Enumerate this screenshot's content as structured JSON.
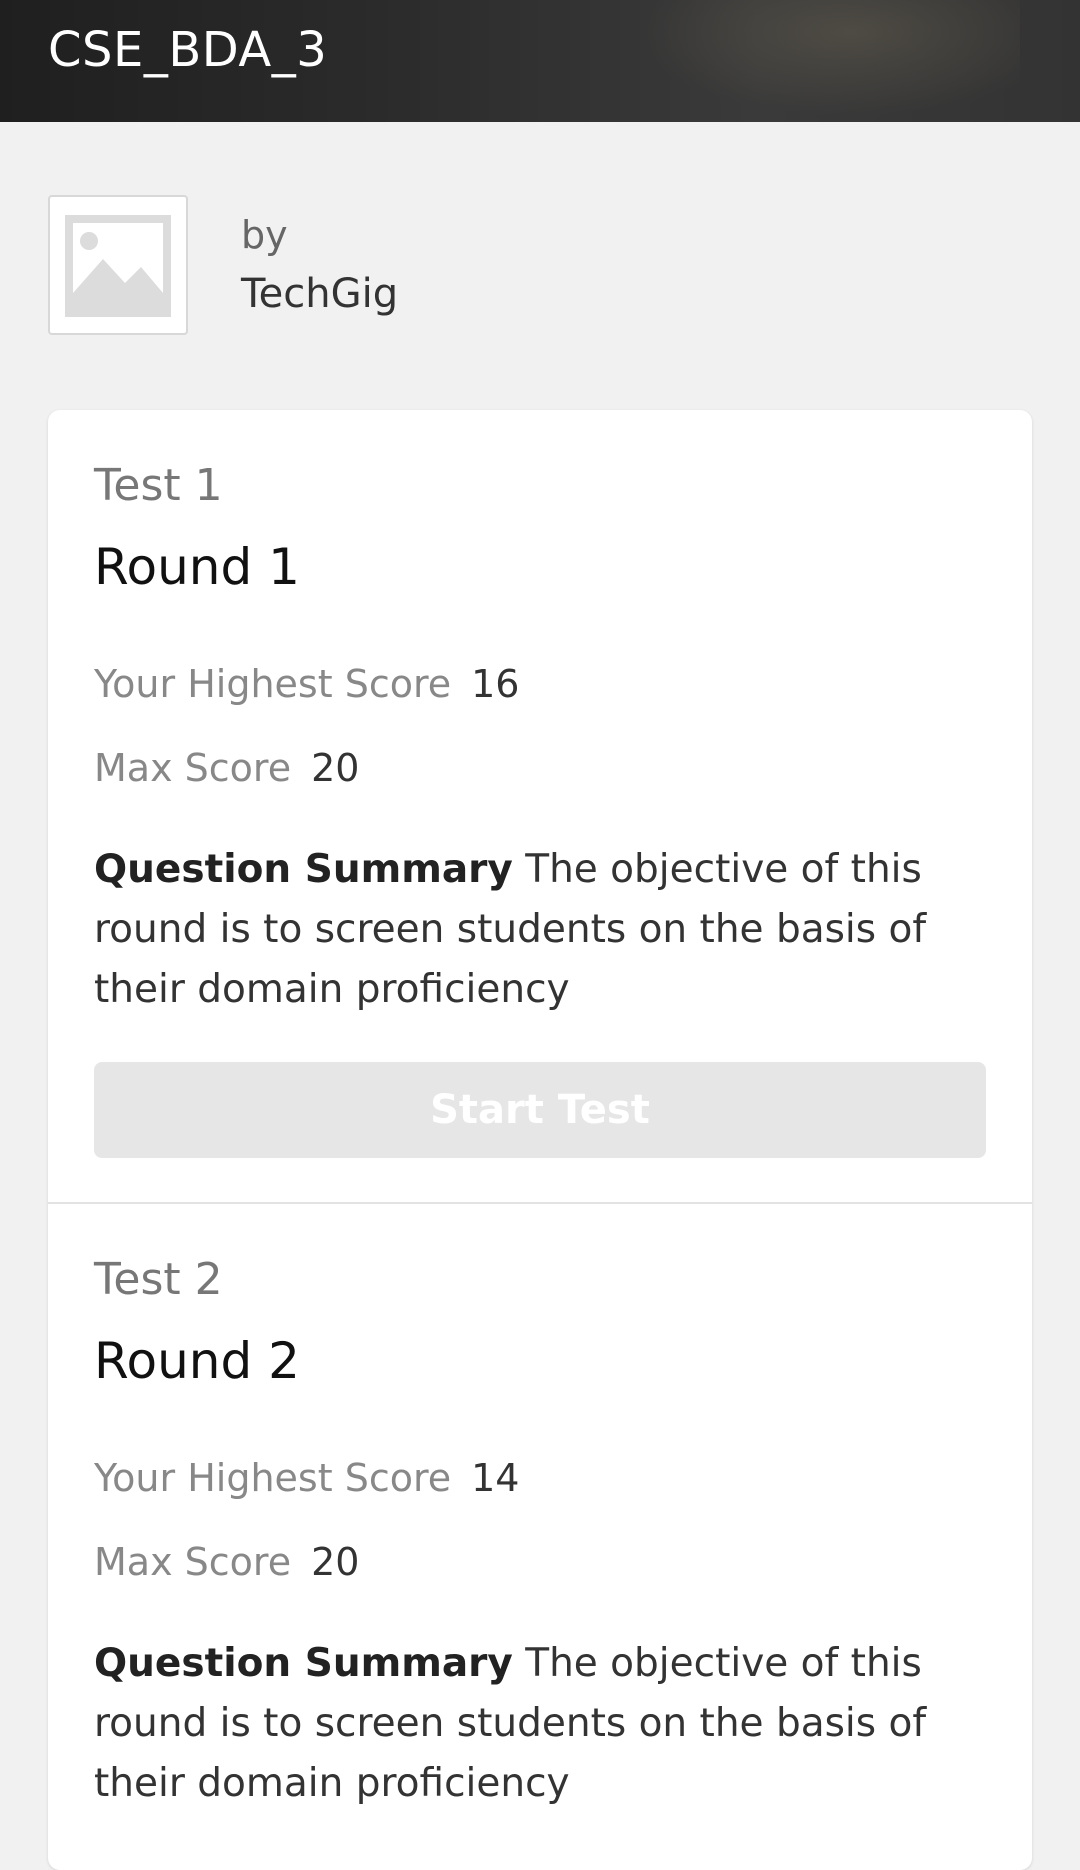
{
  "header": {
    "title": "CSE_BDA_3"
  },
  "provider": {
    "by": "by",
    "name": "TechGig",
    "logo_icon": "image-placeholder-icon"
  },
  "tests": [
    {
      "test_label": "Test 1",
      "round_title": "Round 1",
      "highest_score_label": "Your Highest Score",
      "highest_score": "16",
      "max_score_label": "Max Score",
      "max_score": "20",
      "summary_label": "Question Summary",
      "summary_text": "The objective of this round is to screen students on the basis of their domain proficiency",
      "button_label": "Start Test"
    },
    {
      "test_label": "Test 2",
      "round_title": "Round 2",
      "highest_score_label": "Your Highest Score",
      "highest_score": "14",
      "max_score_label": "Max Score",
      "max_score": "20",
      "summary_label": "Question Summary",
      "summary_text": "The objective of this round is to screen students on the basis of their domain proficiency"
    }
  ]
}
